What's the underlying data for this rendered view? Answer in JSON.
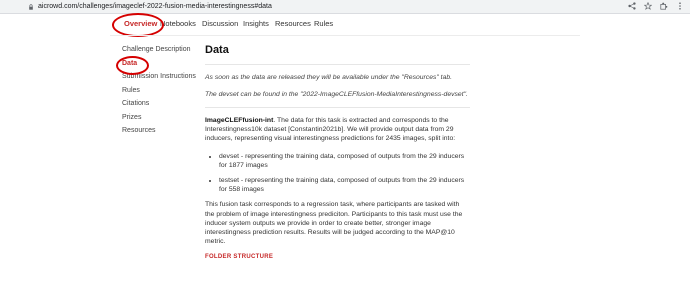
{
  "browser": {
    "url": "aicrowd.com/challenges/imageclef-2022-fusion-media-interestingness#data"
  },
  "nav": {
    "tabs": [
      {
        "label": "Overview",
        "active": true
      },
      {
        "label": "Notebooks",
        "active": false
      },
      {
        "label": "Discussion",
        "active": false
      },
      {
        "label": "Insights",
        "active": false
      },
      {
        "label": "Resources",
        "active": false
      },
      {
        "label": "Rules",
        "active": false
      }
    ]
  },
  "sidebar": {
    "items": [
      {
        "label": "Challenge Description",
        "active": false
      },
      {
        "label": "Data",
        "active": true
      },
      {
        "label": "Submission Instructions",
        "active": false
      },
      {
        "label": "Rules",
        "active": false
      },
      {
        "label": "Citations",
        "active": false
      },
      {
        "label": "Prizes",
        "active": false
      },
      {
        "label": "Resources",
        "active": false
      }
    ]
  },
  "main": {
    "title": "Data",
    "note1": "As soon as the data are released they will be available under the \"Resources\" tab.",
    "note2": "The devset can be found in the \"2022-ImageCLEFfusion-MediaInterestingness-devset\".",
    "intro_bold": "ImageCLEFfusion-int",
    "intro_rest": ". The data for this task is extracted and corresponds to the Interestingness10k dataset [Constantin2021b]. We will provide output data from 29 inducers, representing visual interestingness predictions for 2435 images, split into:",
    "bullets": [
      "devset - representing the training data, composed of outputs from the 29 inducers for 1877 images",
      "testset - representing the training data, composed of outputs from the 29 inducers for 558 images"
    ],
    "paragraph": "This fusion task corresponds to a regression task, where participants are tasked with the problem of image interestingness prediciton. Participants to this task must use the inducer system outputs we provide in order to create better, stronger image interestingness prediction results. Results will be judged according to the MAP@10 metric.",
    "section_heading": "FOLDER STRUCTURE"
  },
  "colors": {
    "accent": "#c62828",
    "annotation": "#d50000"
  },
  "icons": [
    "lock-icon",
    "share-icon",
    "star-icon",
    "extensions-icon",
    "menu-icon"
  ]
}
